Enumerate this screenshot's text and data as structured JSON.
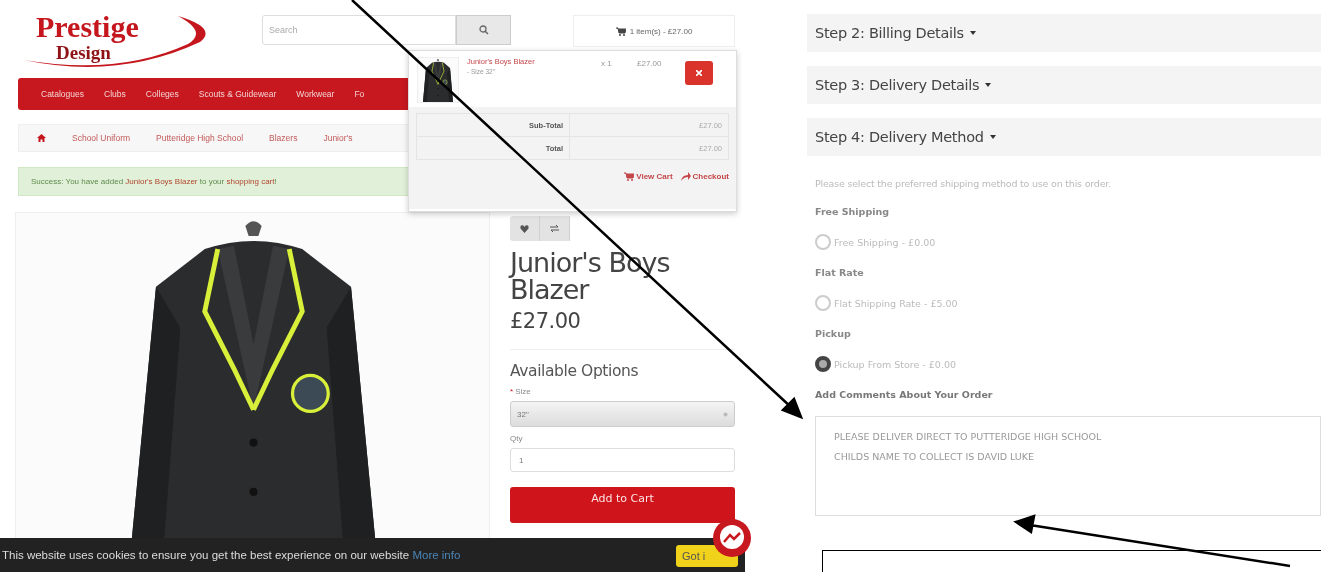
{
  "shop_screenshot": {
    "logo": {
      "name": "Prestige",
      "subtitle": "Design"
    },
    "search": {
      "placeholder": "Search"
    },
    "cart_summary": "1 item(s) - £27.00",
    "nav": [
      "Catalogues",
      "Clubs",
      "Colleges",
      "Scouts & Guidewear",
      "Workwear",
      "Fo"
    ],
    "breadcrumb": [
      "School Uniform",
      "Putteridge High School",
      "Blazers",
      "Junior's"
    ],
    "alert": [
      {
        "kind": "text",
        "text": "Success: You have added "
      },
      {
        "kind": "link",
        "text": "Junior's Boys Blazer"
      },
      {
        "kind": "text",
        "text": " to your "
      },
      {
        "kind": "link",
        "text": "shopping cart"
      },
      {
        "kind": "text",
        "text": "!"
      }
    ],
    "product": {
      "title": "Junior's Boys Blazer",
      "price": "£27.00",
      "options_heading": "Available Options",
      "size": {
        "required_mark": "*",
        "label": "Size",
        "value": "32\""
      },
      "qty": {
        "label": "Qty",
        "value": "1"
      },
      "add_button": "Add to Cart"
    },
    "cart_dropdown": {
      "items": [
        {
          "name": "Junior's Boys Blazer",
          "option": "- Size 32\"",
          "qty": "x 1",
          "price": "£27.00"
        }
      ],
      "totals": [
        {
          "label": "Sub-Total",
          "value": "£27.00"
        },
        {
          "label": "Total",
          "value": "£27.00"
        }
      ],
      "links": [
        {
          "kind": "cart",
          "label": "View Cart"
        },
        {
          "kind": "checkout",
          "label": "Checkout"
        }
      ]
    },
    "cookie_bar": {
      "text": "This website uses cookies to ensure you get the best experience on our website",
      "link": "More info",
      "button": "Got i"
    }
  },
  "checkout_screenshot": {
    "steps": [
      "Step 2: Billing Details",
      "Step 3: Delivery Details",
      "Step 4: Delivery Method"
    ],
    "intro": "Please select the preferred shipping method to use on this order.",
    "methods": [
      {
        "title": "Free Shipping",
        "option": "Free Shipping - £0.00",
        "selected": false
      },
      {
        "title": "Flat Rate",
        "option": "Flat Shipping Rate - £5.00",
        "selected": false
      },
      {
        "title": "Pickup",
        "option": "Pickup From Store - £0.00",
        "selected": true
      }
    ],
    "comments": {
      "label": "Add Comments About Your Order",
      "lines": [
        "PLEASE DELIVER DIRECT TO PUTTERIDGE HIGH SCHOOL",
        "CHILDS NAME TO COLLECT IS DAVID LUKE"
      ]
    }
  }
}
